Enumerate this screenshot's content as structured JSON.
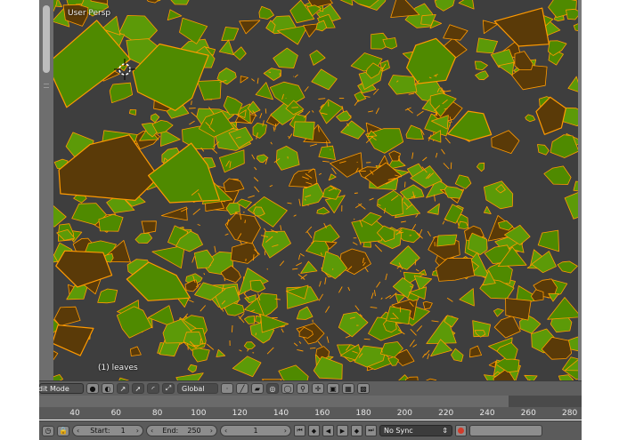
{
  "viewport": {
    "view_label": "User Persp",
    "object_label": "(1) leaves"
  },
  "header": {
    "mode_label": "dit Mode",
    "orientation_label": "Global"
  },
  "timeline": {
    "ticks": [
      "40",
      "60",
      "80",
      "100",
      "120",
      "140",
      "160",
      "180",
      "200",
      "220",
      "240",
      "260",
      "280"
    ]
  },
  "controls": {
    "start_label": "Start:",
    "start_value": "1",
    "end_label": "End:",
    "end_value": "250",
    "current_frame": "1",
    "sync_label": "No Sync"
  },
  "colors": {
    "leaf_green": "#4f8a00",
    "leaf_dark": "#5a3a08",
    "edge_orange": "#ff9a00",
    "background": "#3e3e3e"
  }
}
